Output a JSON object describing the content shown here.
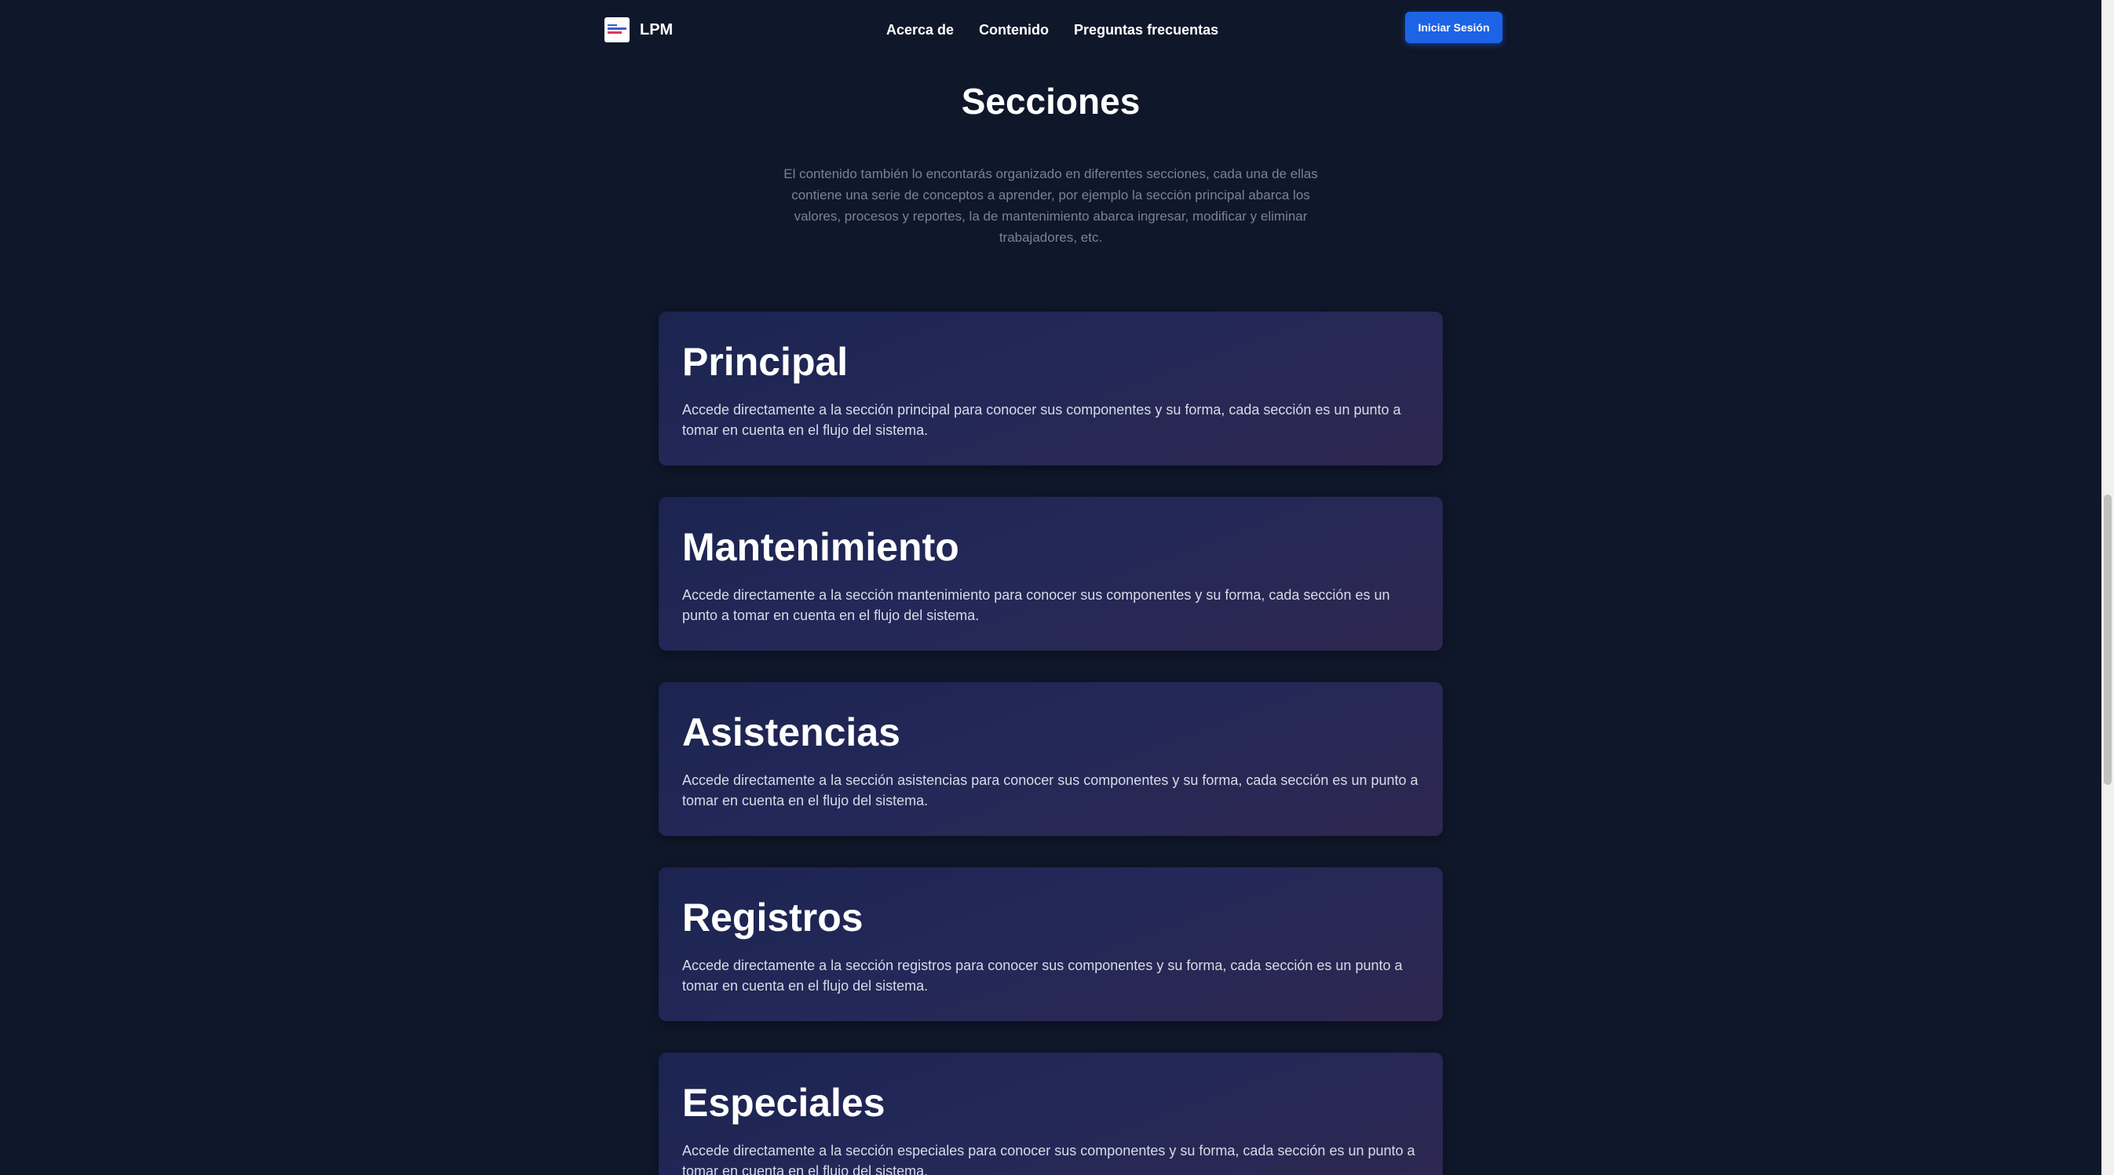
{
  "nav": {
    "logo_alt": "LPM logo",
    "brand": "LPM",
    "links": [
      "Acerca de",
      "Contenido",
      "Preguntas frecuentas"
    ],
    "login_label": "Iniciar Sesión"
  },
  "sections": {
    "title": "Secciones",
    "description": "El contenido también lo encontarás organizado en diferentes secciones, cada una de ellas contiene una serie de conceptos a aprender, por ejemplo la sección principal abarca los valores, procesos y reportes, la de mantenimiento abarca ingresar, modificar y eliminar trabajadores, etc.",
    "cards": [
      {
        "title": "Principal",
        "text": "Accede directamente a la sección principal para conocer sus componentes y su forma, cada sección es un punto a tomar en cuenta en el flujo del sistema."
      },
      {
        "title": "Mantenimiento",
        "text": "Accede directamente a la sección mantenimiento para conocer sus componentes y su forma, cada sección es un punto a tomar en cuenta en el flujo del sistema."
      },
      {
        "title": "Asistencias",
        "text": "Accede directamente a la sección asistencias para conocer sus componentes y su forma, cada sección es un punto a tomar en cuenta en el flujo del sistema."
      },
      {
        "title": "Registros",
        "text": "Accede directamente a la sección registros para conocer sus componentes y su forma, cada sección es un punto a tomar en cuenta en el flujo del sistema."
      },
      {
        "title": "Especiales",
        "text": "Accede directamente a la sección especiales para conocer sus componentes y su forma, cada sección es un punto a tomar en cuenta en el flujo del sistema."
      }
    ]
  },
  "colors": {
    "background": "#0f172a",
    "accent": "#1d63e6",
    "muted_text": "#7b8294"
  }
}
